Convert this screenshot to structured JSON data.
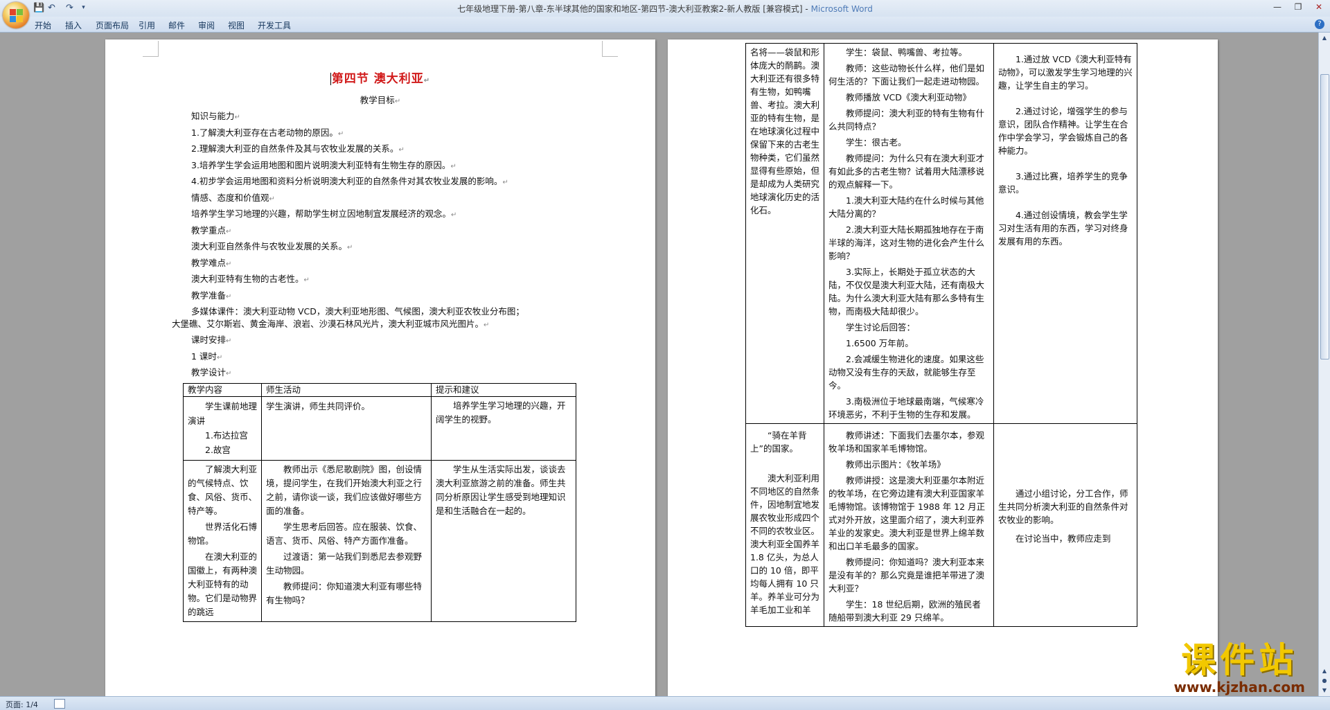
{
  "window": {
    "title": "七年级地理下册-第八章-东半球其他的国家和地区-第四节-澳大利亚教案2-新人教版 [兼容模式]",
    "app_name": "Microsoft Word"
  },
  "ribbon": {
    "tabs": [
      "开始",
      "插入",
      "页面布局",
      "引用",
      "邮件",
      "审阅",
      "视图",
      "开发工具"
    ]
  },
  "page1": {
    "title": "第四节  澳大利亚",
    "subtitle": "教学目标",
    "lines": [
      "知识与能力",
      "1.了解澳大利亚存在古老动物的原因。",
      "2.理解澳大利亚的自然条件及其与农牧业发展的关系。",
      "3.培养学生学会运用地图和图片说明澳大利亚特有生物生存的原因。",
      "4.初步学会运用地图和资料分析说明澳大利亚的自然条件对其农牧业发展的影响。",
      "情感、态度和价值观",
      "培养学生学习地理的兴趣，帮助学生树立因地制宜发展经济的观念。",
      "教学重点",
      "澳大利亚自然条件与农牧业发展的关系。",
      "教学难点",
      "澳大利亚特有生物的古老性。",
      "教学准备",
      "多媒体课件：澳大利亚动物 VCD，澳大利亚地形图、气候图，澳大利亚农牧业分布图；",
      "大堡礁、艾尔斯岩、黄金海岸、浪岩、沙漠石林风光片，澳大利亚城市风光图片。",
      "课时安排",
      "1 课时",
      "教学设计"
    ],
    "table": {
      "headers": [
        "教学内容",
        "师生活动",
        "提示和建议"
      ],
      "row1": {
        "col1": [
          "学生课前地理演讲",
          "1.布达拉宫",
          "2.故宫"
        ],
        "col2": [
          "学生演讲，师生共同评价。"
        ],
        "col3": [
          "培养学生学习地理的兴趣，开阔学生的视野。"
        ]
      },
      "row2": {
        "col1": [
          "了解澳大利亚的气候特点、饮食、风俗、货币、特产等。",
          "世界活化石博物馆。",
          "在澳大利亚的国徽上，有两种澳大利亚特有的动物。它们是动物界的跳远"
        ],
        "col2": [
          "教师出示《悉尼歌剧院》图，创设情境，提问学生，在我们开始澳大利亚之行之前，请你谈一谈，我们应该做好哪些方面的准备。",
          "学生思考后回答。应在服装、饮食、语言、货币、风俗、特产方面作准备。",
          "过渡语：第一站我们到悉尼去参观野生动物园。",
          "教师提问：你知道澳大利亚有哪些特有生物吗？"
        ],
        "col3": [
          "学生从生活实际出发，谈谈去澳大利亚旅游之前的准备。师生共同分析原因让学生感受到地理知识是和生活融合在一起的。"
        ]
      }
    }
  },
  "page2": {
    "table": {
      "row1": {
        "col1": [
          "名将——袋鼠和形体庞大的鸸鹋。澳大利亚还有很多特有生物，如鸭嘴兽、考拉。澳大利亚的特有生物，是在地球演化过程中保留下来的古老生物种类，它们虽然显得有些原始，但是却成为人类研究地球演化历史的活化石。"
        ],
        "col2": [
          "学生：袋鼠、鸭嘴兽、考拉等。",
          "教师：这些动物长什么样，他们是如何生活的？下面让我们一起走进动物园。",
          "教师播放 VCD《澳大利亚动物》",
          "教师提问：澳大利亚的特有生物有什么共同特点？",
          "学生：很古老。",
          "教师提问：为什么只有在澳大利亚才有如此多的古老生物？试着用大陆漂移说的观点解释一下。",
          "1.澳大利亚大陆约在什么时候与其他大陆分离的？",
          "2.澳大利亚大陆长期孤独地存在于南半球的海洋，这对生物的进化会产生什么影响？",
          "3.实际上，长期处于孤立状态的大陆，不仅仅是澳大利亚大陆，还有南极大陆。为什么澳大利亚大陆有那么多特有生物，而南极大陆却很少。",
          "学生讨论后回答：",
          "1.6500 万年前。",
          "2.会减缓生物进化的速度。如果这些动物又没有生存的天敌，就能够生存至今。",
          "3.南极洲位于地球最南端，气候寒冷环境恶劣，不利于生物的生存和发展。"
        ],
        "col3": [
          "1.通过放 VCD《澳大利亚特有动物》，可以激发学生学习地理的兴趣，让学生自主的学习。",
          "2.通过讨论，增强学生的参与意识，团队合作精神。让学生在合作中学会学习，学会锻炼自己的各种能力。",
          "3.通过比赛，培养学生的竞争意识。",
          "4.通过创设情境，教会学生学习对生活有用的东西，学习对终身发展有用的东西。"
        ]
      },
      "row2": {
        "col1": [
          "“骑在羊背上”的国家。",
          "澳大利亚利用不同地区的自然条件，因地制宜地发展农牧业形成四个不同的农牧业区。澳大利亚全国养羊 1.8 亿头，为总人口的 10 倍，即平均每人拥有 10 只羊。养羊业可分为羊毛加工业和羊"
        ],
        "col2": [
          "教师讲述：下面我们去墨尔本，参观牧羊场和国家羊毛博物馆。",
          "教师出示图片：《牧羊场》",
          "教师讲授：这是澳大利亚墨尔本附近的牧羊场，在它旁边建有澳大利亚国家羊毛博物馆。该博物馆于 1988 年 12 月正式对外开放，这里面介绍了，澳大利亚养羊业的发家史。澳大利亚是世界上绵羊数和出口羊毛最多的国家。",
          "教师提问：你知道吗？澳大利亚本来是没有羊的？那么究竟是谁把羊带进了澳大利亚？",
          "学生：18 世纪后期，欧洲的殖民者随船带到澳大利亚 29 只绵羊。"
        ],
        "col3": [
          "通过小组讨论，分工合作，师生共同分析澳大利亚的自然条件对农牧业的影响。",
          "在讨论当中，教师应走到"
        ]
      }
    }
  },
  "status": {
    "page_indicator": "页面: 1/4"
  },
  "watermark": {
    "main": "课件站",
    "url": "www.kjzhan.com"
  }
}
